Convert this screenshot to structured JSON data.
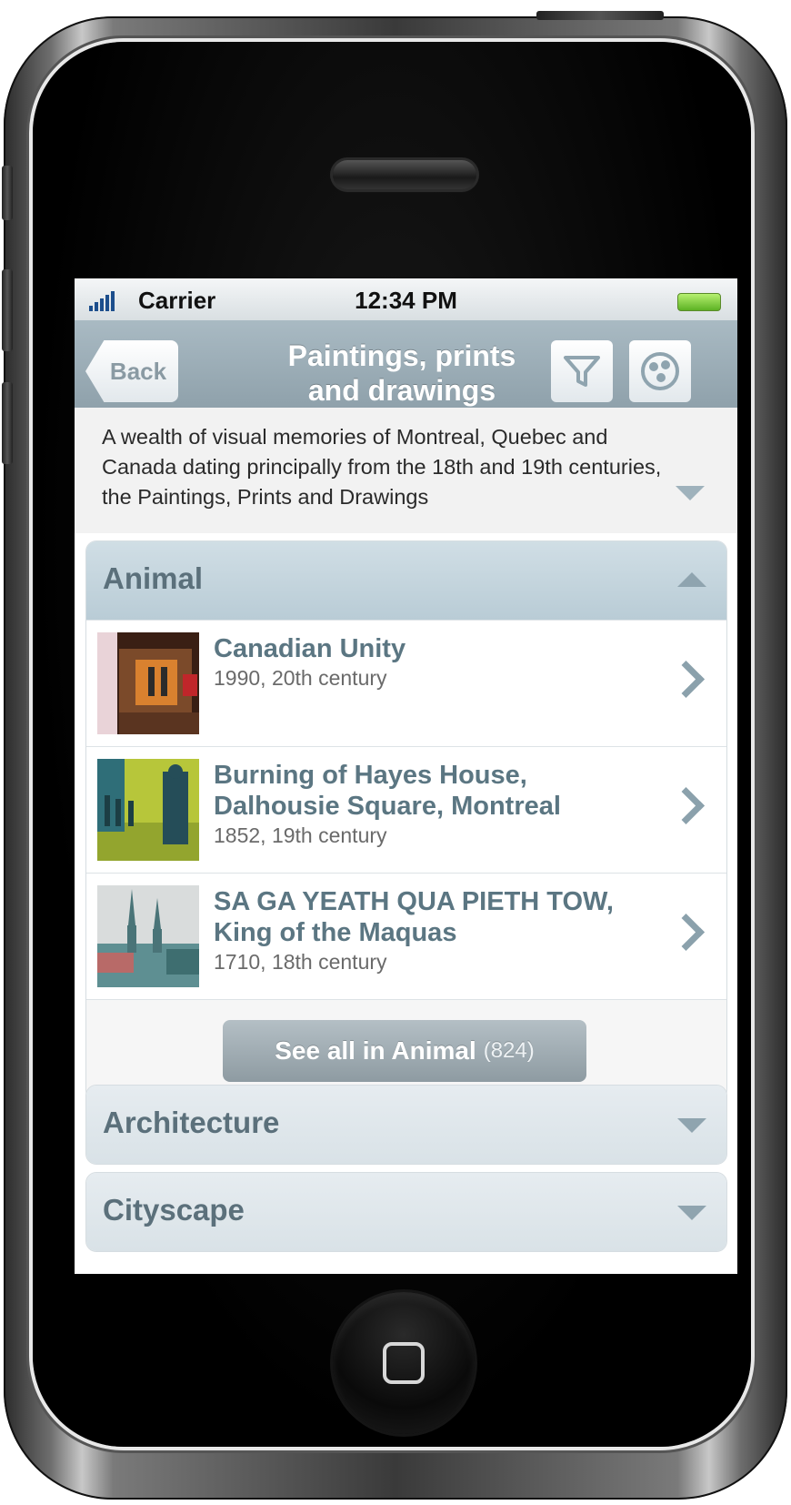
{
  "status_bar": {
    "carrier": "Carrier",
    "time": "12:34 PM"
  },
  "nav": {
    "back_label": "Back",
    "title_line1": "Paintings, prints",
    "title_line2": "and drawings"
  },
  "description": "A wealth of visual memories of Montreal, Quebec and Canada dating principally from the 18th and 19th centuries, the Paintings, Prints and Drawings",
  "categories": [
    {
      "title": "Animal",
      "expanded": true,
      "items": [
        {
          "title": "Canadian Unity",
          "meta": "1990, 20th century"
        },
        {
          "title": "Burning of Hayes House, Dalhousie Square, Montreal",
          "meta": "1852, 19th century"
        },
        {
          "title": "SA GA YEATH QUA PIETH TOW, King of the Maquas",
          "meta": "1710, 18th century"
        }
      ],
      "see_all_label": "See all in Animal",
      "see_all_count": "(824)"
    },
    {
      "title": "Architecture",
      "expanded": false
    },
    {
      "title": "Cityscape",
      "expanded": false
    }
  ],
  "colors": {
    "nav_bar": "#98aab4",
    "accent_text": "#5b7682",
    "header_text": "#5b707b"
  },
  "icons": [
    "back-arrow",
    "filter-icon",
    "share-icon",
    "chevron-right-icon",
    "expand-down-icon",
    "collapse-up-icon"
  ]
}
